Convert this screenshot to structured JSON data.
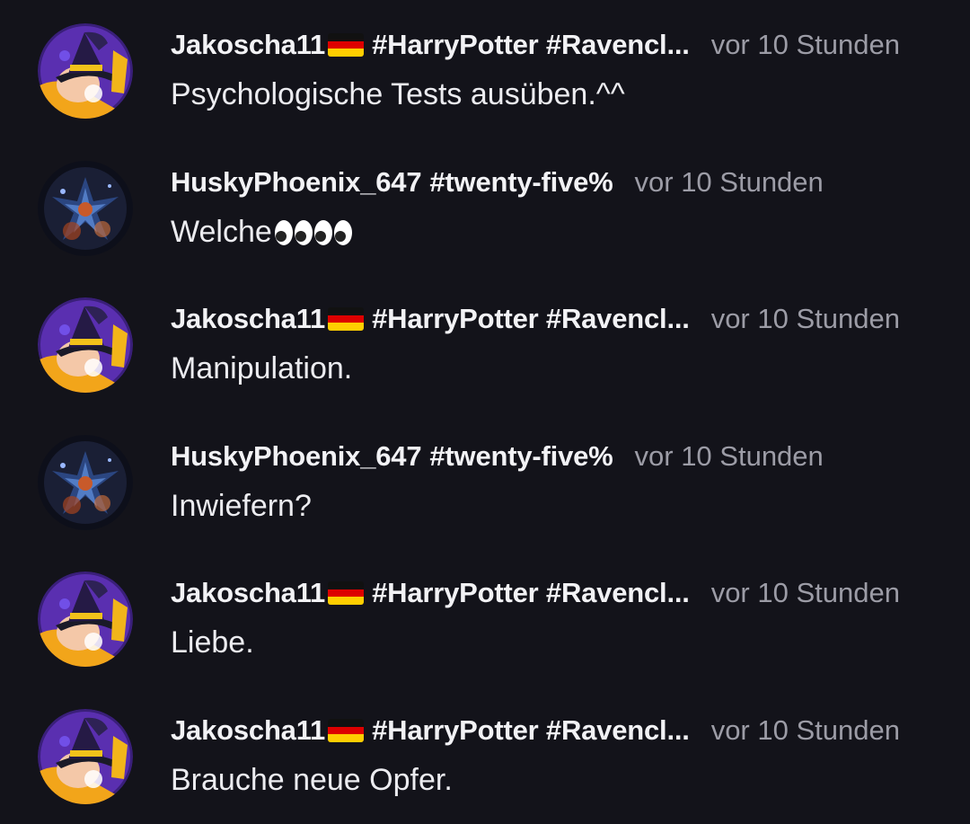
{
  "comments": [
    {
      "user": "Jakoscha11",
      "flag": "germany-flag",
      "tags": "#HarryPotter #Ravencl...",
      "time": "vor 10 Stunden",
      "text": "Psychologische Tests ausüben.^^",
      "avatar": "wizard-hat-avatar"
    },
    {
      "user": "HuskyPhoenix_647",
      "flag": "",
      "tags": "#twenty-five%",
      "time": "vor 10 Stunden",
      "text": "Welche",
      "emoji": [
        "eyes-emoji",
        "eyes-emoji"
      ],
      "avatar": "phoenix-avatar"
    },
    {
      "user": "Jakoscha11",
      "flag": "germany-flag",
      "tags": "#HarryPotter #Ravencl...",
      "time": "vor 10 Stunden",
      "text": "Manipulation.",
      "avatar": "wizard-hat-avatar"
    },
    {
      "user": "HuskyPhoenix_647",
      "flag": "",
      "tags": "#twenty-five%",
      "time": "vor 10 Stunden",
      "text": "Inwiefern?",
      "avatar": "phoenix-avatar"
    },
    {
      "user": "Jakoscha11",
      "flag": "germany-flag",
      "tags": "#HarryPotter #Ravencl...",
      "time": "vor 10 Stunden",
      "text": "Liebe.",
      "avatar": "wizard-hat-avatar"
    },
    {
      "user": "Jakoscha11",
      "flag": "germany-flag",
      "tags": "#HarryPotter #Ravencl...",
      "time": "vor 10 Stunden",
      "text": "Brauche neue Opfer.",
      "avatar": "wizard-hat-avatar"
    }
  ],
  "colors": {
    "background": "#13131a",
    "text": "#ececf0",
    "timestamp": "#9c9ca6"
  }
}
